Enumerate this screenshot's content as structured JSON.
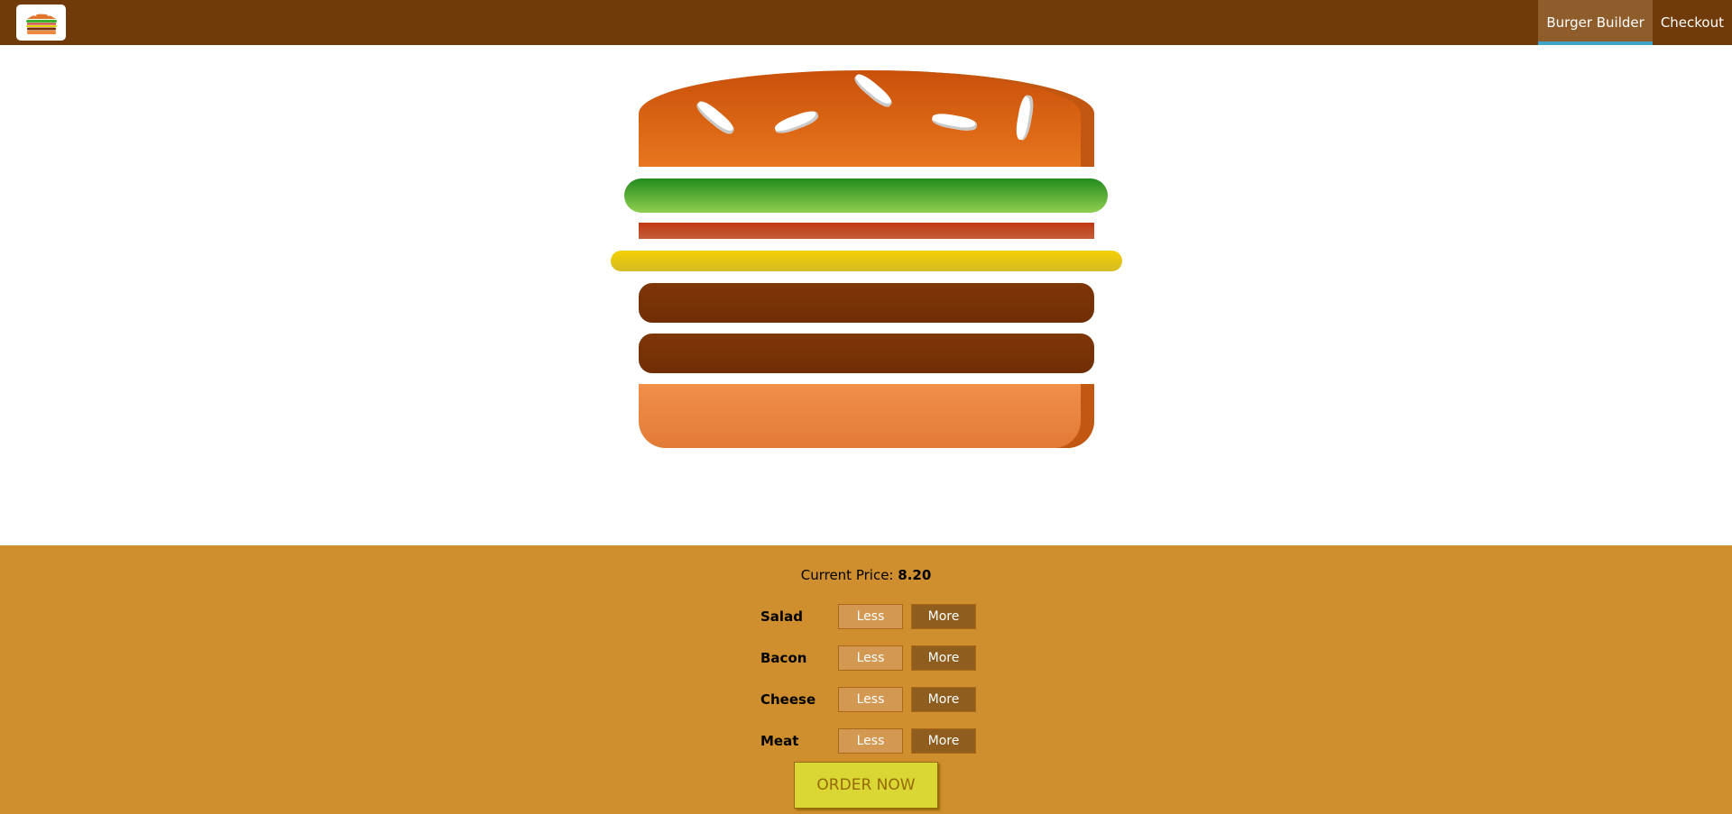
{
  "header": {
    "logo_icon": "burger-logo-icon",
    "nav": [
      {
        "label": "Burger Builder",
        "active": true
      },
      {
        "label": "Checkout",
        "active": false
      }
    ]
  },
  "burger": {
    "layers": [
      "bread-top",
      "salad",
      "bacon",
      "cheese",
      "meat",
      "meat",
      "bread-bottom"
    ]
  },
  "controls": {
    "price_label": "Current Price:",
    "price_value": "8.20",
    "ingredients": [
      {
        "label": "Salad",
        "less": "Less",
        "more": "More"
      },
      {
        "label": "Bacon",
        "less": "Less",
        "more": "More"
      },
      {
        "label": "Cheese",
        "less": "Less",
        "more": "More"
      },
      {
        "label": "Meat",
        "less": "Less",
        "more": "More"
      }
    ],
    "order_label": "ORDER NOW"
  },
  "colors": {
    "toolbar": "#703B09",
    "nav_active": "#8F5C2C",
    "nav_underline": "#40A4C8",
    "controls_bg": "#CF8F2E",
    "order_button": "#DAD735"
  }
}
